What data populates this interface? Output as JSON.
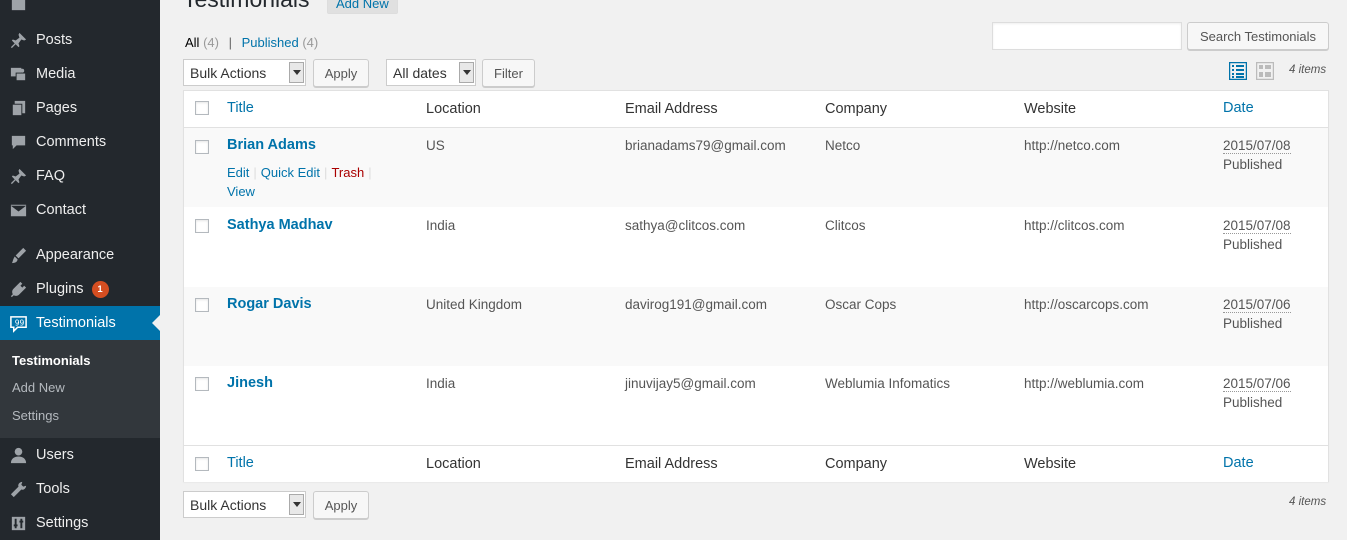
{
  "sidebar": {
    "items": [
      {
        "label": "",
        "icon": "dashboard-icon"
      },
      {
        "label": "Posts",
        "icon": "pin-icon"
      },
      {
        "label": "Media",
        "icon": "media-icon"
      },
      {
        "label": "Pages",
        "icon": "pages-icon"
      },
      {
        "label": "Comments",
        "icon": "comments-icon"
      },
      {
        "label": "FAQ",
        "icon": "pin-icon"
      },
      {
        "label": "Contact",
        "icon": "mail-icon"
      },
      {
        "label": "Appearance",
        "icon": "brush-icon"
      },
      {
        "label": "Plugins",
        "icon": "plugin-icon",
        "badge": "1"
      },
      {
        "label": "Testimonials",
        "icon": "testimonial-icon"
      },
      {
        "label": "Users",
        "icon": "users-icon"
      },
      {
        "label": "Tools",
        "icon": "tools-icon"
      },
      {
        "label": "Settings",
        "icon": "settings-icon"
      }
    ],
    "submenu": [
      "Testimonials",
      "Add New",
      "Settings"
    ]
  },
  "header": {
    "title": "Testimonials",
    "add_new": "Add New"
  },
  "filters": {
    "all_label": "All",
    "all_count": "(4)",
    "separator": "|",
    "published_label": "Published",
    "published_count": "(4)"
  },
  "search": {
    "value": "",
    "button": "Search Testimonials"
  },
  "bulk": {
    "selected": "Bulk Actions",
    "apply": "Apply"
  },
  "dates": {
    "selected": "All dates",
    "filter": "Filter"
  },
  "items_count": "4 items",
  "table": {
    "columns": [
      "Title",
      "Location",
      "Email Address",
      "Company",
      "Website",
      "Date"
    ],
    "row_actions": {
      "edit": "Edit",
      "quick_edit": "Quick Edit",
      "trash": "Trash",
      "view": "View",
      "sep": "|"
    },
    "rows": [
      {
        "title": "Brian Adams",
        "location": "US",
        "email": "brianadams79@gmail.com",
        "company": "Netco",
        "website": "http://netco.com",
        "date": "2015/07/08",
        "status": "Published"
      },
      {
        "title": "Sathya Madhav",
        "location": "India",
        "email": "sathya@clitcos.com",
        "company": "Clitcos",
        "website": "http://clitcos.com",
        "date": "2015/07/08",
        "status": "Published"
      },
      {
        "title": "Rogar Davis",
        "location": "United Kingdom",
        "email": "davirog191@gmail.com",
        "company": "Oscar Cops",
        "website": "http://oscarcops.com",
        "date": "2015/07/06",
        "status": "Published"
      },
      {
        "title": "Jinesh",
        "location": "India",
        "email": "jinuvijay5@gmail.com",
        "company": "Weblumia Infomatics",
        "website": "http://weblumia.com",
        "date": "2015/07/06",
        "status": "Published"
      }
    ]
  },
  "colors": {
    "sidebar_bg": "#23282d",
    "accent": "#0073aa",
    "badge": "#d54e21",
    "trash": "#aa0000"
  }
}
